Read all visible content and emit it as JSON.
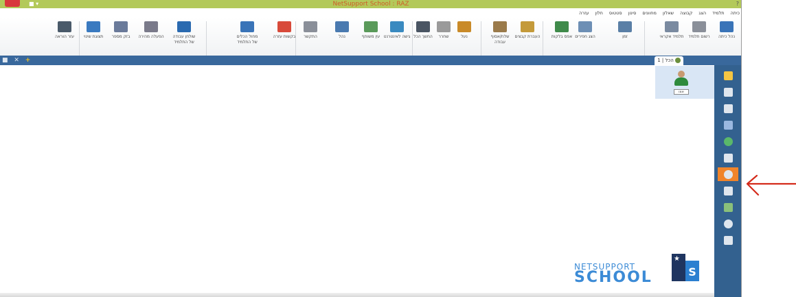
{
  "window": {
    "title": "NetSupport School : RAZ",
    "quick_access": "■ ▾",
    "help": "?"
  },
  "menu": [
    "כיתה",
    "תלמיד",
    "הצג",
    "קבוצה",
    "שאלון",
    "מחוונים",
    "סינון",
    "סטטוס",
    "חלון",
    "עזרה"
  ],
  "ribbon": [
    {
      "id": "manage-class",
      "label": "נהל כיתה",
      "icon": "class-icon",
      "color": "#3a74b8"
    },
    {
      "id": "register",
      "label": "רשום תלמיד",
      "icon": "register-icon",
      "color": "#8a8f99"
    },
    {
      "id": "call-student",
      "label": "תלמיד אקראי",
      "icon": "random-student-icon",
      "color": "#7a8aa0"
    },
    {
      "id": "quiz",
      "label": "זמן",
      "icon": "timer-icon",
      "color": "#5a7fa6"
    },
    {
      "id": "show",
      "label": "הצג חפירים",
      "icon": "show-icon",
      "color": "#6d8fb5"
    },
    {
      "id": "lock",
      "label": "אפס בלקות",
      "icon": "reset-icon",
      "color": "#3f8a4a"
    },
    {
      "id": "file-transfer",
      "label": "העברת קבצים",
      "icon": "file-transfer-icon",
      "color": "#c49a3a"
    },
    {
      "id": "send-collect",
      "label": "שלח/אסוף עבודה",
      "icon": "send-collect-icon",
      "color": "#9a7a4a"
    },
    {
      "id": "lock-screen",
      "label": "נעל",
      "icon": "lock-icon",
      "color": "#c98a28"
    },
    {
      "id": "unlock",
      "label": "שחרר",
      "icon": "unlock-icon",
      "color": "#9a9a9a"
    },
    {
      "id": "blank-screen",
      "label": "החשך הכל",
      "icon": "monitor-icon",
      "color": "#4a5563"
    },
    {
      "id": "internet",
      "label": "גישה לאינטרנט",
      "icon": "internet-icon",
      "color": "#3a8ac0"
    },
    {
      "id": "shared-view",
      "label": "עין משותף",
      "icon": "globe-icon",
      "color": "#5a9a5a"
    },
    {
      "id": "control",
      "label": "נהל",
      "icon": "control-icon",
      "color": "#4a7ab0"
    },
    {
      "id": "chat",
      "label": "התקשר",
      "icon": "chat-icon",
      "color": "#8a8f99"
    },
    {
      "id": "help-request",
      "label": "בקשות עזרה",
      "icon": "help-request-icon",
      "color": "#d84a3a"
    },
    {
      "id": "student-tools",
      "label": "מחול הכלים של התלמיד",
      "icon": "student-tools-icon",
      "color": "#3a74b8"
    },
    {
      "id": "worksheet",
      "label": "שולחן עבודה של התלמיד",
      "icon": "desktop-icon",
      "color": "#2a6ab0"
    },
    {
      "id": "launch",
      "label": "הפעלה מהירה",
      "icon": "launch-icon",
      "color": "#7a7a8a"
    },
    {
      "id": "thumbnail",
      "label": "בזק מספר",
      "icon": "thumbnail-icon",
      "color": "#6a7a9a"
    },
    {
      "id": "change",
      "label": "תצוגת שינוי",
      "icon": "change-icon",
      "color": "#3a7ac0"
    },
    {
      "id": "guide",
      "label": "עזר הוראה",
      "icon": "guide-icon",
      "color": "#4a5a6a"
    }
  ],
  "tabstrip": {
    "controls": "■ ✕",
    "plus": "+",
    "group_tab": "הכל | 1"
  },
  "student": {
    "name": "אצו"
  },
  "sidebar": [
    {
      "id": "home",
      "icon": "home-icon",
      "color": "#f5c542"
    },
    {
      "id": "grid",
      "icon": "grid-icon",
      "color": "#dfe6ee"
    },
    {
      "id": "audio",
      "icon": "headphones-icon",
      "color": "#dfe6ee"
    },
    {
      "id": "security",
      "icon": "shield-icon",
      "color": "#9ab8e0"
    },
    {
      "id": "web",
      "icon": "globe-icon",
      "color": "#5ab86a"
    },
    {
      "id": "apps",
      "icon": "window-icon",
      "color": "#dfe6ee"
    },
    {
      "id": "quiz",
      "icon": "pie-chart-icon",
      "color": "#dfe6ee",
      "active": true
    },
    {
      "id": "print",
      "icon": "printer-icon",
      "color": "#dfe6ee"
    },
    {
      "id": "devices",
      "icon": "usb-icon",
      "color": "#8ac07a"
    },
    {
      "id": "history",
      "icon": "clock-icon",
      "color": "#dfe6ee"
    },
    {
      "id": "stats",
      "icon": "chart-icon",
      "color": "#dfe6ee"
    }
  ],
  "logo": {
    "net": "NETSUPPORT",
    "school": "SCHOOL",
    "mark": "S"
  },
  "annotation": {
    "color": "#d42a1a"
  }
}
